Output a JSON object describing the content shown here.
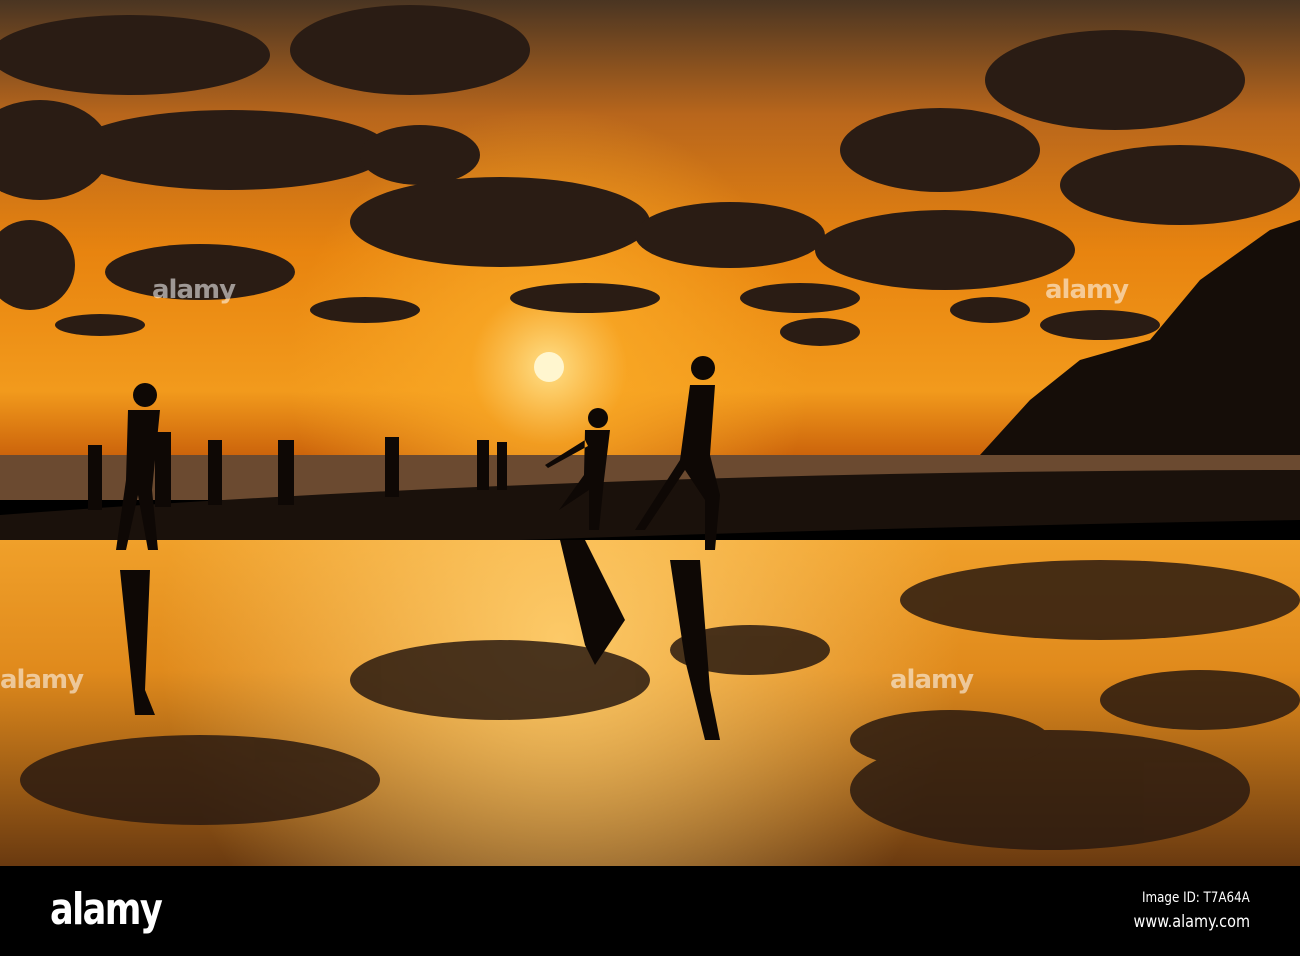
{
  "photo": {
    "subject": "silhouettes-on-beach-at-sunset",
    "colors": {
      "sky_top": "#3a2a1e",
      "sky_mid": "#e07a10",
      "horizon": "#f5a623",
      "sun": "#fff3c0",
      "sand": "#1a120c",
      "water": "#d9861a"
    }
  },
  "watermark": {
    "text": "alamy"
  },
  "footer": {
    "logo": "alamy",
    "image_id": "Image ID: T7A64A",
    "url": "www.alamy.com"
  }
}
